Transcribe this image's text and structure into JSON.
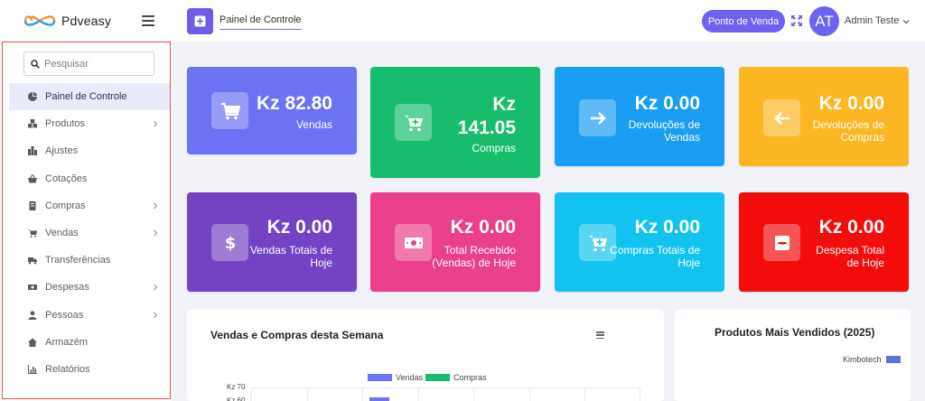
{
  "app": {
    "name": "Pdveasy"
  },
  "sidebar": {
    "search_placeholder": "Pesquisar",
    "items": [
      {
        "label": "Painel de Controle",
        "icon": "pie-chart-icon",
        "active": true,
        "has_submenu": false
      },
      {
        "label": "Produtos",
        "icon": "boxes-icon",
        "active": false,
        "has_submenu": true
      },
      {
        "label": "Ajustes",
        "icon": "adjust-boxes-icon",
        "active": false,
        "has_submenu": false
      },
      {
        "label": "Cotações",
        "icon": "basket-icon",
        "active": false,
        "has_submenu": false
      },
      {
        "label": "Compras",
        "icon": "receipt-icon",
        "active": false,
        "has_submenu": true
      },
      {
        "label": "Vendas",
        "icon": "cart-icon",
        "active": false,
        "has_submenu": true
      },
      {
        "label": "Transferências",
        "icon": "transfer-icon",
        "active": false,
        "has_submenu": false
      },
      {
        "label": "Despesas",
        "icon": "money-icon",
        "active": false,
        "has_submenu": true
      },
      {
        "label": "Pessoas",
        "icon": "person-icon",
        "active": false,
        "has_submenu": true
      },
      {
        "label": "Armazém",
        "icon": "home-icon",
        "active": false,
        "has_submenu": false
      },
      {
        "label": "Relatórios",
        "icon": "bar-chart-icon",
        "active": false,
        "has_submenu": false
      }
    ]
  },
  "topbar": {
    "page_title": "Painel de Controle",
    "pos_button": "Ponto de Venda",
    "avatar_initials": "AT",
    "user_name": "Admin Teste"
  },
  "cards": [
    {
      "value": "Kz 82.80",
      "label": "Vendas",
      "color": "#6b72f3",
      "icon": "cart-icon"
    },
    {
      "value": "Kz 141.05",
      "label": "Compras",
      "color": "#17bd6d",
      "icon": "cart-plus-icon"
    },
    {
      "value": "Kz 0.00",
      "label": "Devoluções de Vendas",
      "color": "#1a9df2",
      "icon": "arrow-right-icon"
    },
    {
      "value": "Kz 0.00",
      "label": "Devoluções de Compras",
      "color": "#fbb623",
      "icon": "arrow-left-icon"
    },
    {
      "value": "Kz 0.00",
      "label": "Vendas Totais de Hoje",
      "color": "#7443c3",
      "icon": "dollar-icon"
    },
    {
      "value": "Kz 0.00",
      "label": "Total Recebido (Vendas) de Hoje",
      "color": "#ea3f8c",
      "icon": "banknote-icon"
    },
    {
      "value": "Kz 0.00",
      "label": "Compras Totais de Hoje",
      "color": "#13c3ef",
      "icon": "cart-plus-icon"
    },
    {
      "value": "Kz 0.00",
      "label": "Despesa Total de Hoje",
      "color": "#f20c0c",
      "icon": "minus-icon"
    }
  ],
  "week_chart": {
    "title": "Vendas e Compras desta Semana",
    "legend": [
      "Vendas",
      "Compras"
    ],
    "colors": {
      "Vendas": "#6b72f3",
      "Compras": "#17bd6d"
    },
    "y_ticks": [
      "Kz 70",
      "Kz 60"
    ]
  },
  "top_products": {
    "title": "Produtos Mais Vendidos (2025)",
    "legend_item": "Kimbotech",
    "legend_color": "#5b73d9"
  }
}
